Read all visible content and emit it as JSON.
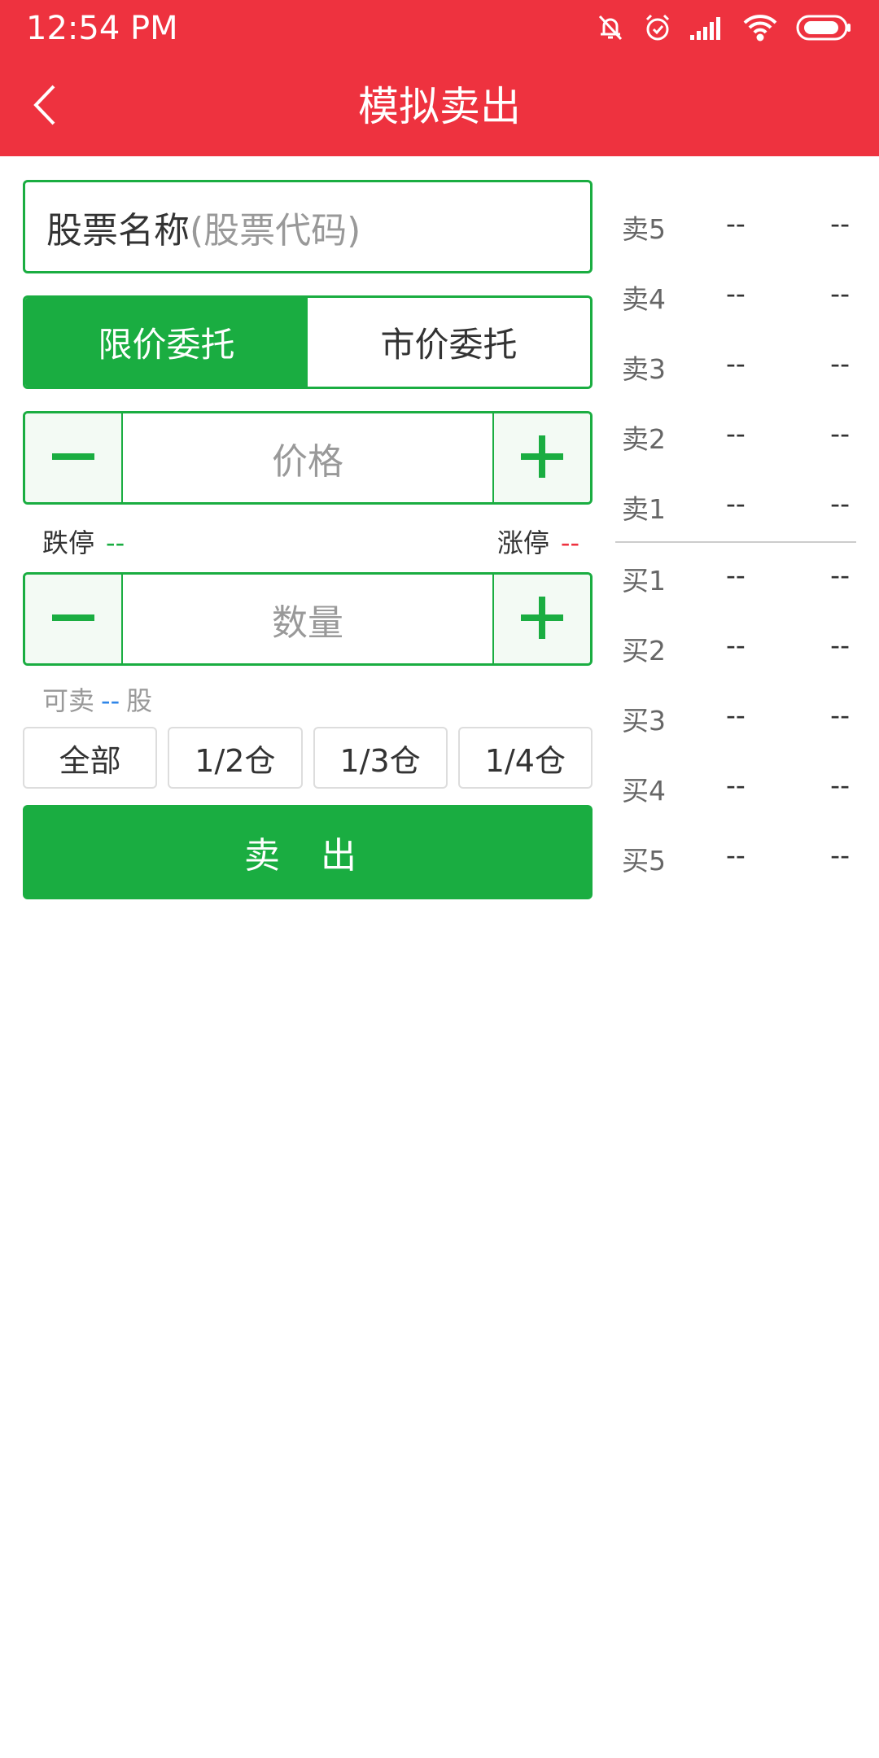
{
  "status_bar": {
    "time": "12:54 PM",
    "icons": [
      "bell-off-icon",
      "alarm-icon",
      "signal-icon",
      "wifi-icon",
      "battery-icon"
    ]
  },
  "header": {
    "back_icon": "chevron-left-icon",
    "title": "模拟卖出"
  },
  "stock_input": {
    "name_label": "股票名称",
    "code_hint": "(股票代码)"
  },
  "order_type": {
    "limit_label": "限价委托",
    "market_label": "市价委托",
    "selected": "限价委托"
  },
  "price": {
    "placeholder": "价格",
    "minus_icon": "minus-icon",
    "plus_icon": "plus-icon"
  },
  "limits": {
    "down_label": "跌停",
    "down_value": "--",
    "up_label": "涨停",
    "up_value": "--"
  },
  "quantity": {
    "placeholder": "数量",
    "minus_icon": "minus-icon",
    "plus_icon": "plus-icon"
  },
  "available": {
    "prefix": "可卖",
    "value": "--",
    "unit": "股"
  },
  "portions": [
    "全部",
    "1/2仓",
    "1/3仓",
    "1/4仓"
  ],
  "sell_button": "卖 出",
  "order_book": {
    "asks": [
      {
        "label": "卖5",
        "price": "--",
        "volume": "--"
      },
      {
        "label": "卖4",
        "price": "--",
        "volume": "--"
      },
      {
        "label": "卖3",
        "price": "--",
        "volume": "--"
      },
      {
        "label": "卖2",
        "price": "--",
        "volume": "--"
      },
      {
        "label": "卖1",
        "price": "--",
        "volume": "--"
      }
    ],
    "bids": [
      {
        "label": "买1",
        "price": "--",
        "volume": "--"
      },
      {
        "label": "买2",
        "price": "--",
        "volume": "--"
      },
      {
        "label": "买3",
        "price": "--",
        "volume": "--"
      },
      {
        "label": "买4",
        "price": "--",
        "volume": "--"
      },
      {
        "label": "买5",
        "price": "--",
        "volume": "--"
      }
    ]
  },
  "colors": {
    "header": "#ee323f",
    "accent_green": "#1aad41",
    "limit_up_red": "#ee323f",
    "available_blue": "#2f86e8"
  }
}
